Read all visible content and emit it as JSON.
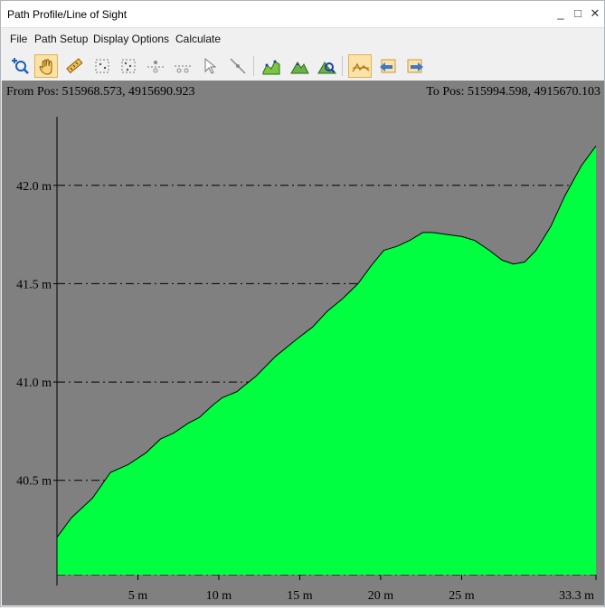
{
  "window": {
    "title": "Path Profile/Line of Sight",
    "minimize": "_",
    "maximize": "□",
    "close": "✕"
  },
  "menu": [
    "File",
    "Path Setup",
    "Display Options",
    "Calculate"
  ],
  "toolbar": {
    "groups": [
      [
        "zoom-in-icon",
        "pan-hand-icon",
        "measure-ruler-icon",
        "select-area-icon",
        "select-points-icon",
        "insert-vertex-icon",
        "split-path-icon",
        "select-arrow-icon",
        "delete-vertex-icon"
      ],
      [
        "profile-graph-icon",
        "terrain-view-icon",
        "terrain-analyze-icon"
      ],
      [
        "line-of-sight-icon",
        "reverse-path-icon",
        "forward-path-icon"
      ]
    ],
    "active": "pan-hand-icon"
  },
  "colors": {
    "plot_background": "#808080",
    "fill": "#00ff40",
    "terrain_line": "#000000",
    "grid": "#000000"
  },
  "from_pos": "From Pos: 515968.573, 4915690.923",
  "to_pos": "To Pos: 515994.598, 4915670.103",
  "chart_data": {
    "type": "area",
    "x_unit": "m",
    "y_unit": "m",
    "xlim": [
      0,
      33.3
    ],
    "ylim": [
      40.02,
      42.22
    ],
    "x_ticks": [
      {
        "value": 5,
        "label": "5 m"
      },
      {
        "value": 10,
        "label": "10 m"
      },
      {
        "value": 15,
        "label": "15 m"
      },
      {
        "value": 20,
        "label": "20 m"
      },
      {
        "value": 25,
        "label": "25 m"
      },
      {
        "value": 33.3,
        "label": "33.3 m"
      }
    ],
    "y_ticks": [
      {
        "value": 40.5,
        "label": "40.5 m"
      },
      {
        "value": 41.0,
        "label": "41.0 m"
      },
      {
        "value": 41.5,
        "label": "41.5 m"
      },
      {
        "value": 42.0,
        "label": "42.0 m"
      }
    ],
    "grid": "horizontal dash-dot",
    "x": [
      0,
      0.9,
      2.2,
      3.3,
      4.4,
      5.5,
      6.4,
      7.2,
      8.1,
      8.8,
      9.6,
      10.2,
      11.1,
      12.3,
      13.5,
      14.7,
      15.8,
      16.7,
      17.6,
      18.6,
      19.4,
      20.2,
      21.0,
      21.8,
      22.6,
      23.2,
      24.1,
      25.0,
      25.8,
      26.7,
      27.5,
      28.2,
      28.9,
      29.6,
      30.5,
      31.4,
      32.4,
      33.3
    ],
    "y": [
      40.21,
      40.31,
      40.41,
      40.54,
      40.58,
      40.64,
      40.71,
      40.74,
      40.79,
      40.82,
      40.88,
      40.92,
      40.95,
      41.03,
      41.13,
      41.21,
      41.28,
      41.36,
      41.42,
      41.5,
      41.59,
      41.67,
      41.69,
      41.72,
      41.76,
      41.76,
      41.75,
      41.74,
      41.72,
      41.67,
      41.62,
      41.6,
      41.61,
      41.67,
      41.79,
      41.95,
      42.1,
      42.2
    ]
  }
}
